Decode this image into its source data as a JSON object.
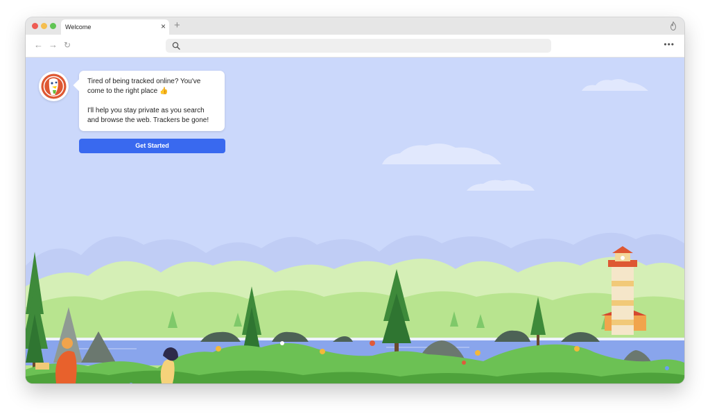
{
  "tab": {
    "title": "Welcome",
    "close": "×",
    "new_tab": "+"
  },
  "toolbar": {
    "back": "←",
    "forward": "→",
    "reload": "↻",
    "address_value": "",
    "menu": "•••"
  },
  "icons": {
    "fire": "fire-icon",
    "search": "search-icon",
    "duck": "duckduckgo-logo-icon"
  },
  "welcome": {
    "message_line1": "Tired of being tracked online? You've come to the right place 👍",
    "message_line2": "I'll help you stay private as you search and browse the web. Trackers be gone!",
    "button_label": "Get Started"
  },
  "colors": {
    "sky": "#cbd8fb",
    "accent": "#3969ef",
    "brand_orange": "#de5833"
  }
}
